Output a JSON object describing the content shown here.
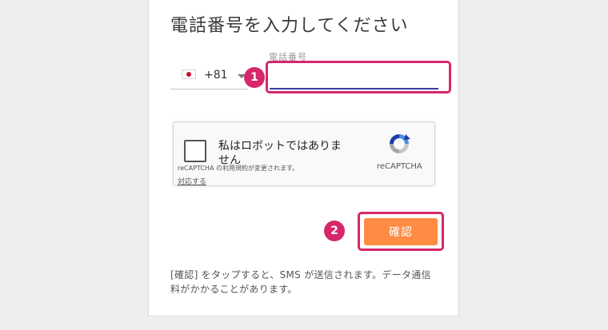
{
  "page": {
    "title": "電話番号を入力してください"
  },
  "country": {
    "flag": "jp-flag-icon",
    "dial_code": "+81"
  },
  "phone": {
    "label": "電話番号",
    "value": ""
  },
  "recaptcha": {
    "checkbox_label": "私はロボットではありません",
    "brand": "reCAPTCHA",
    "terms_text": "reCAPTCHA の利用規約が変更されます。",
    "terms_link": "対応する"
  },
  "confirm": {
    "label": "確認"
  },
  "note": {
    "text": "[確認] をタップすると、SMS が送信されます。データ通信料がかかることがあります。"
  },
  "annotations": {
    "badge1": "1",
    "badge2": "2",
    "highlight_color": "#d6276a"
  },
  "colors": {
    "confirm_button": "#ff8c42",
    "input_underline": "#3c3ca8"
  }
}
